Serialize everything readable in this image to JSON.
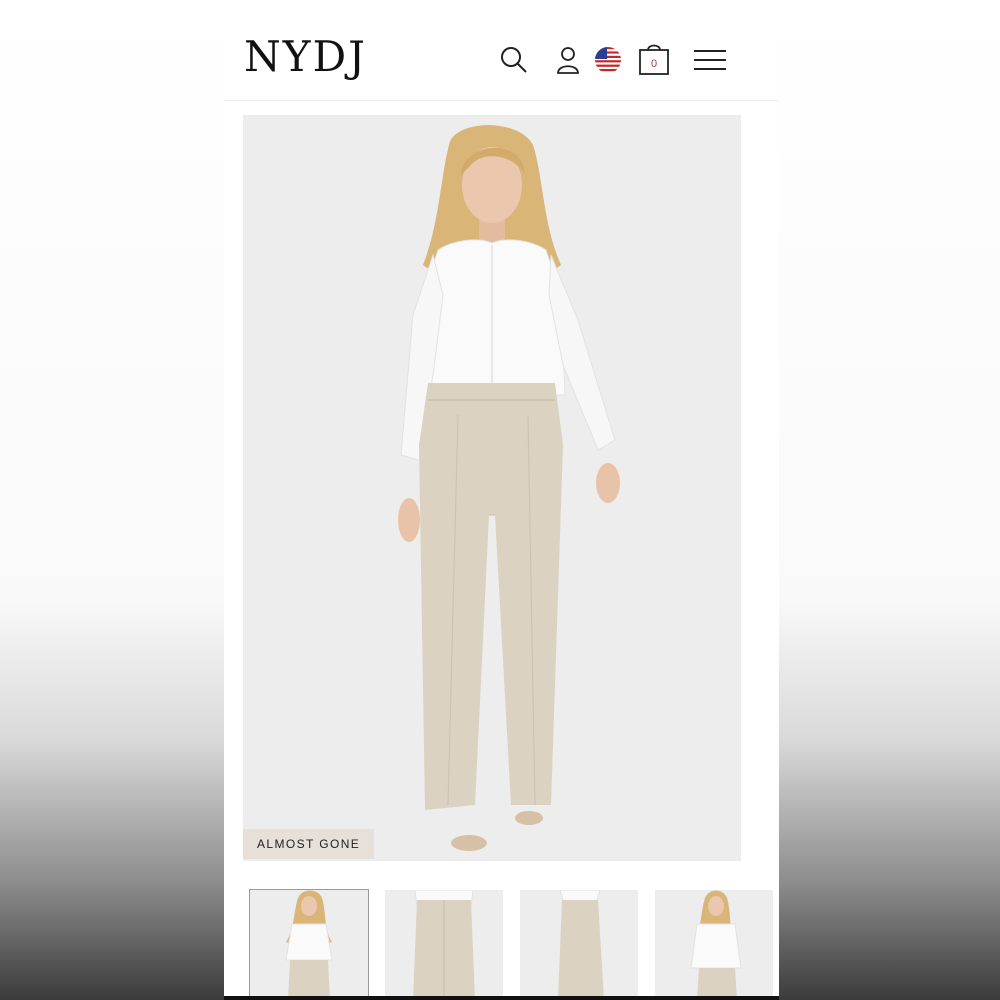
{
  "brand": {
    "logo_text": "NYDJ"
  },
  "header": {
    "icons": [
      "search-icon",
      "account-icon",
      "us-flag-icon",
      "shopping-bag-icon",
      "hamburger-menu-icon"
    ],
    "cart_count": "0"
  },
  "product": {
    "badge": "ALMOST GONE",
    "thumbnails": [
      {
        "name": "front-view",
        "active": true
      },
      {
        "name": "back-view",
        "active": false
      },
      {
        "name": "side-view",
        "active": false
      },
      {
        "name": "front-view-alt",
        "active": false
      }
    ]
  },
  "colors": {
    "blouse": "#ffffff",
    "pants": "#dcd2c2",
    "hair": "#d9b678",
    "skin": "#e8c3a8",
    "badge_bg": "#e6e0d8",
    "photo_bg": "#ededed"
  }
}
